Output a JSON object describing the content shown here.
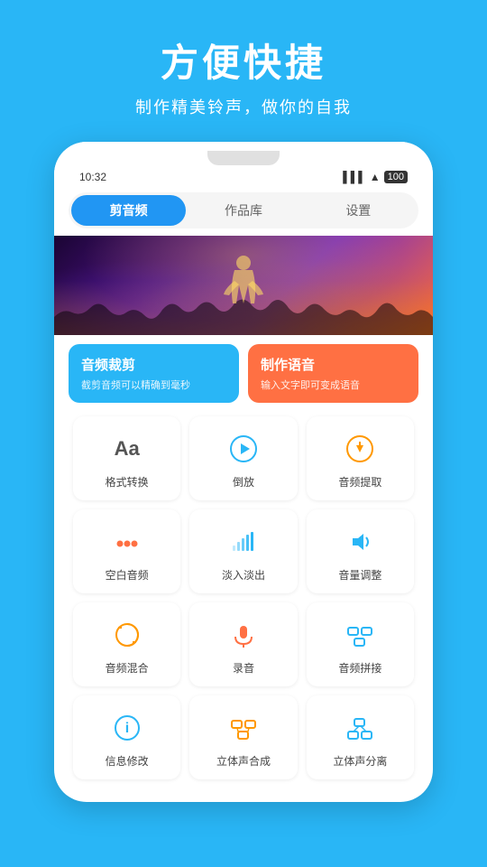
{
  "header": {
    "title": "方便快捷",
    "subtitle": "制作精美铃声，做你的自我"
  },
  "status_bar": {
    "time": "10:32",
    "signal": "信号图标",
    "wifi": "Wi-Fi",
    "battery": "100"
  },
  "tabs": [
    {
      "label": "剪音频",
      "active": true
    },
    {
      "label": "作品库",
      "active": false
    },
    {
      "label": "设置",
      "active": false
    }
  ],
  "cards": [
    {
      "title": "音频裁剪",
      "desc": "截剪音频可以精确到毫秒",
      "color": "blue"
    },
    {
      "title": "制作语音",
      "desc": "输入文字即可变成语音",
      "color": "orange"
    }
  ],
  "grid_items": [
    {
      "icon": "Aa",
      "label": "格式转换",
      "icon_type": "text"
    },
    {
      "icon": "▶",
      "label": "倒放",
      "icon_type": "symbol"
    },
    {
      "icon": "⚡",
      "label": "音频提取",
      "icon_type": "symbol"
    },
    {
      "icon": "•••",
      "label": "空白音频",
      "icon_type": "dots"
    },
    {
      "icon": "📊",
      "label": "淡入淡出",
      "icon_type": "bars"
    },
    {
      "icon": "🔊",
      "label": "音量调整",
      "icon_type": "symbol"
    },
    {
      "icon": "↺",
      "label": "音频混合",
      "icon_type": "symbol"
    },
    {
      "icon": "🎤",
      "label": "录音",
      "icon_type": "symbol"
    },
    {
      "icon": "⊞",
      "label": "音频拼接",
      "icon_type": "symbol"
    },
    {
      "icon": "ℹ",
      "label": "信息修改",
      "icon_type": "symbol"
    },
    {
      "icon": "⊟",
      "label": "立体声合成",
      "icon_type": "symbol"
    },
    {
      "icon": "⊠",
      "label": "立体声分离",
      "icon_type": "symbol"
    }
  ]
}
